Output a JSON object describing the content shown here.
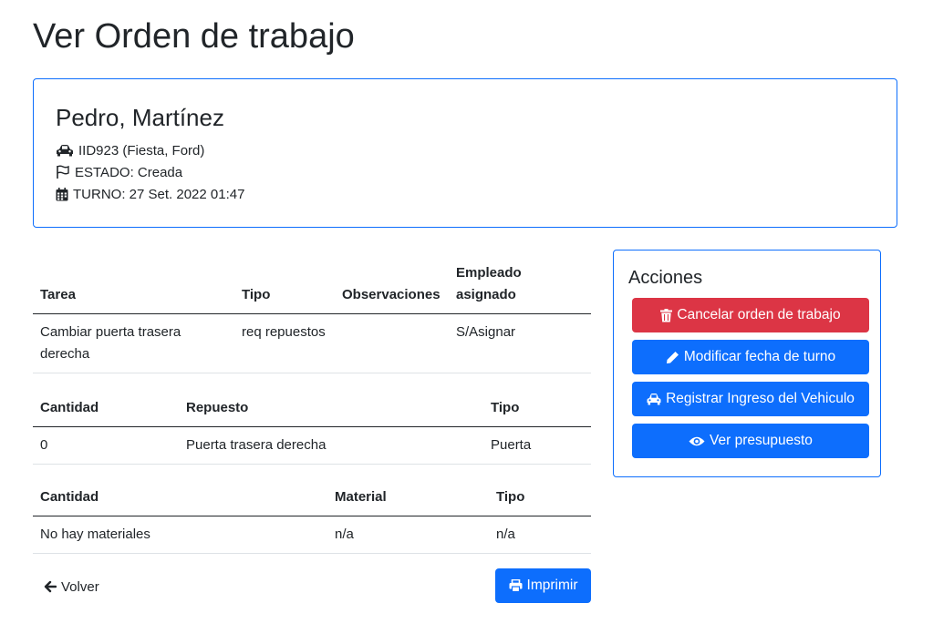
{
  "page": {
    "title": "Ver Orden de trabajo"
  },
  "client": {
    "name": "Pedro, Martínez",
    "vehicle": "IID923 (Fiesta, Ford)",
    "status": "ESTADO: Creada",
    "turn": "TURNO: 27 Set. 2022 01:47"
  },
  "tasks_table": {
    "headers": [
      "Tarea",
      "Tipo",
      "Observaciones",
      "Empleado asignado"
    ],
    "rows": [
      [
        "Cambiar puerta trasera derecha",
        "req repuestos",
        "",
        "S/Asignar"
      ]
    ]
  },
  "parts_table": {
    "headers": [
      "Cantidad",
      "Repuesto",
      "Tipo"
    ],
    "rows": [
      [
        "0",
        "Puerta trasera derecha",
        "Puerta"
      ]
    ]
  },
  "materials_table": {
    "headers": [
      "Cantidad",
      "Material",
      "Tipo"
    ],
    "rows": [
      [
        "No hay materiales",
        "n/a",
        "n/a"
      ]
    ]
  },
  "footer": {
    "back_label": "Volver",
    "print_label": "Imprimir"
  },
  "actions": {
    "title": "Acciones",
    "cancel_label": "Cancelar orden de trabajo",
    "modify_label": "Modificar fecha de turno",
    "register_label": "Registrar Ingreso del Vehiculo",
    "budget_label": "Ver presupuesto"
  },
  "colors": {
    "primary": "#0d6efd",
    "danger": "#dc3545",
    "text": "#212529"
  },
  "icons": [
    "car-icon",
    "flag-icon",
    "calendar-icon",
    "arrow-left-icon",
    "printer-icon",
    "trash-icon",
    "pencil-icon",
    "eye-icon"
  ]
}
